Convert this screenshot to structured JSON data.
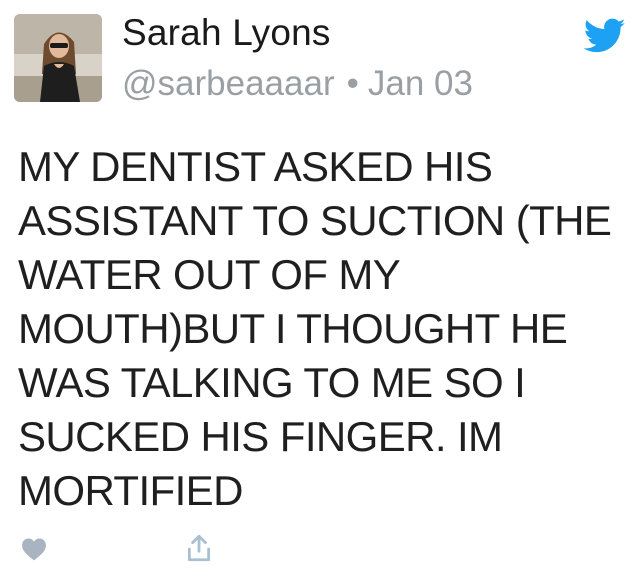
{
  "tweet": {
    "author": {
      "display_name": "Sarah Lyons",
      "handle": "@sarbeaaaar",
      "avatar": "profile-photo"
    },
    "date": "Jan 03",
    "separator": "•",
    "text_lines": [
      "MY DENTIST ASKED HIS",
      "ASSISTANT TO SUCTION (THE",
      "WATER OUT OF MY",
      "MOUTH)BUT I THOUGHT HE",
      "WAS TALKING TO ME SO I",
      "SUCKED HIS FINGER. IM",
      "MORTIFIED"
    ],
    "icons": {
      "brand": "twitter-bird-icon",
      "like": "heart-icon",
      "share": "share-icon"
    },
    "colors": {
      "brand_blue": "#1da1f2",
      "meta_gray": "#9a9fa4",
      "action_gray": "#a8c0d4"
    }
  }
}
